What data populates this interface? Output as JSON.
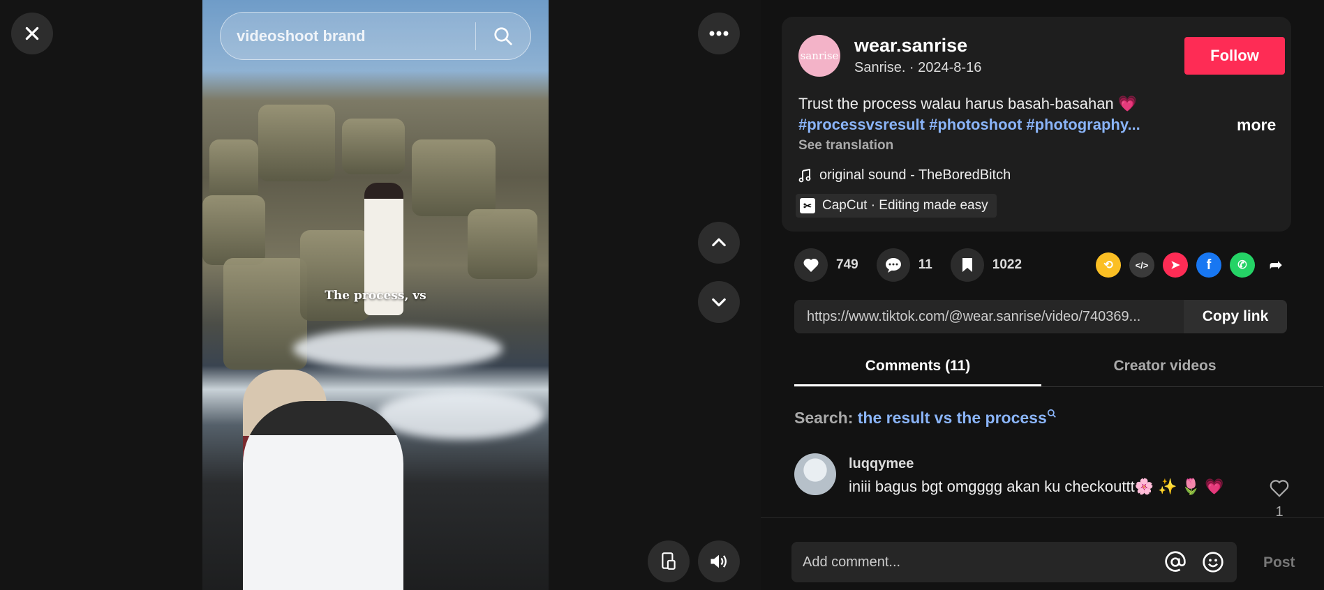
{
  "video": {
    "search_text": "videoshoot brand",
    "overlay_caption": "The process, vs"
  },
  "controls": {
    "close": "close-icon",
    "more": "more-horizontal-icon",
    "prev": "chevron-up-icon",
    "next": "chevron-down-icon",
    "pip": "floating-player-icon",
    "volume": "volume-icon"
  },
  "post": {
    "avatar_text": "sanrise",
    "username": "wear.sanrise",
    "subline": "Sanrise. · 2024-8-16",
    "follow_label": "Follow",
    "description": "Trust the process walau harus basah-basahan 💗",
    "hashtags": "#processvsresult #photoshoot #photography...",
    "more_label": "more",
    "see_translation": "See translation",
    "sound": "original sound - TheBoredBitch",
    "capcut_label": "CapCut · Editing made easy"
  },
  "actions": {
    "likes": "749",
    "comments": "11",
    "saves": "1022"
  },
  "share": {
    "colors": {
      "repost": "#fbbf24",
      "embed": "#3a3a3a",
      "send": "#fe2c55",
      "facebook": "#1877f2",
      "whatsapp": "#25d366"
    }
  },
  "link": {
    "url": "https://www.tiktok.com/@wear.sanrise/video/740369...",
    "copy_label": "Copy link"
  },
  "tabs": [
    {
      "label": "Comments (11)"
    },
    {
      "label": "Creator videos"
    }
  ],
  "related": {
    "prefix": "Search:",
    "query": "the result vs the process"
  },
  "comments": [
    {
      "user": "luqqymee",
      "text": "iniii bagus bgt omgggg akan ku checkouttt🌸 ✨ 🌷 💗",
      "likes": "1"
    }
  ],
  "composer": {
    "placeholder": "Add comment...",
    "post_label": "Post"
  },
  "accent": "#fe2c55",
  "link_color": "#8ab4f8"
}
